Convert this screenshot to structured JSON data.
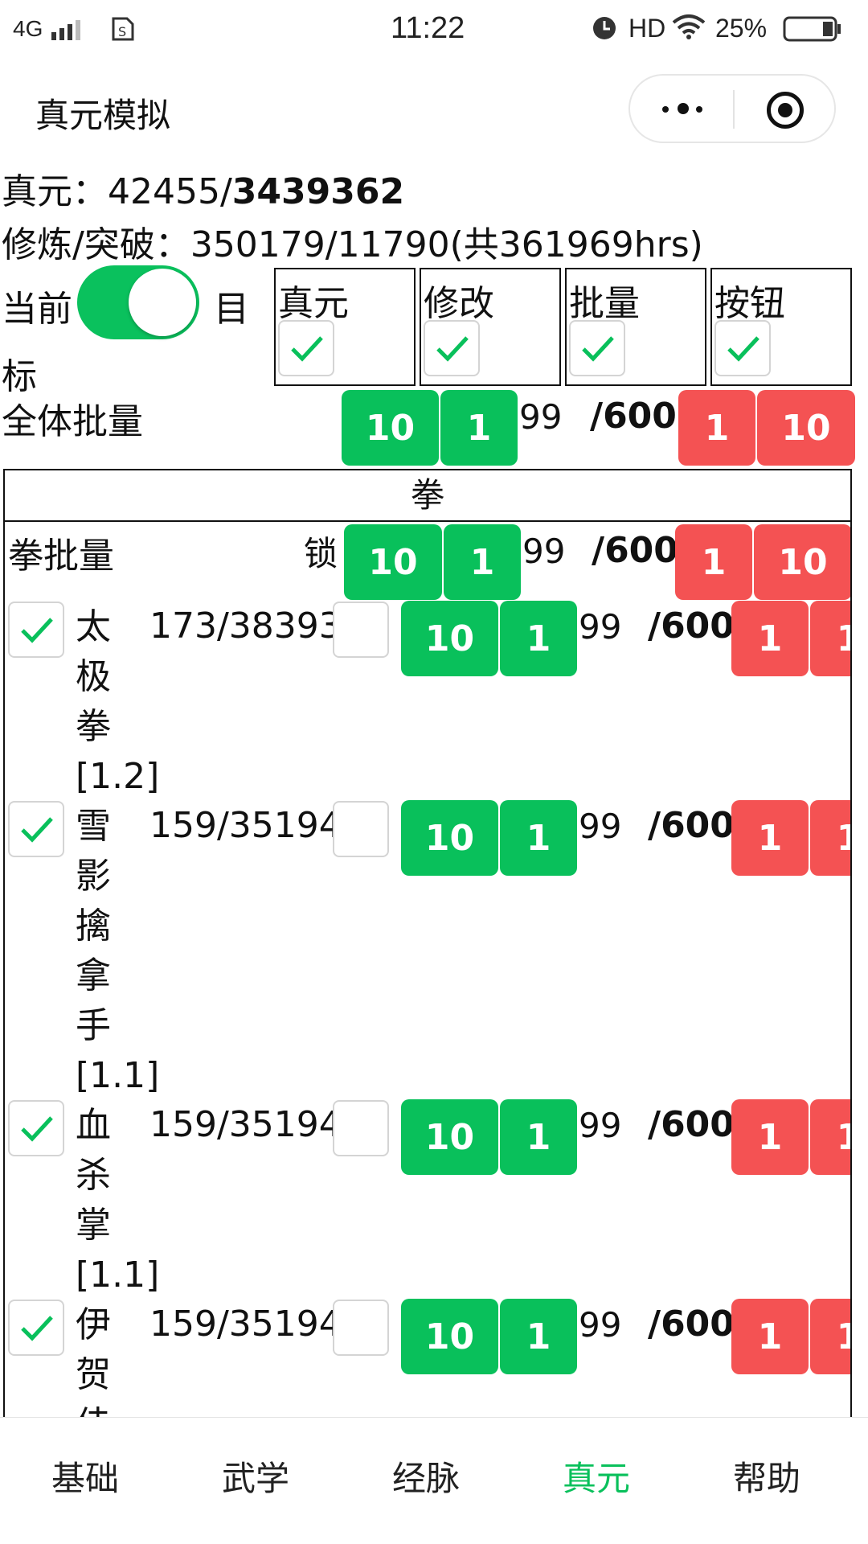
{
  "status_bar": {
    "network": "4G",
    "time": "11:22",
    "hd": "HD",
    "battery": "25%"
  },
  "nav": {
    "title": "真元模拟"
  },
  "summary": {
    "zhenyuan_label": "真元：",
    "zhenyuan_current": "42455/",
    "zhenyuan_total": "3439362",
    "train_line": "修炼/突破：350179/11790(共361969hrs)"
  },
  "mode": {
    "left_label": "当前",
    "right_label": "目",
    "wrap_label": "标",
    "on": true
  },
  "options": [
    {
      "label": "真元",
      "checked": true
    },
    {
      "label": "修改",
      "checked": true
    },
    {
      "label": "批量",
      "checked": true
    },
    {
      "label": "按钮",
      "checked": true
    }
  ],
  "global_batch": {
    "label": "全体批量",
    "plus10": "10",
    "plus1": "1",
    "value": "99",
    "max": "/600",
    "minus1": "1",
    "minus10": "10"
  },
  "group": {
    "title": "拳",
    "batch_label": "拳批量",
    "lock_label": "锁",
    "plus10": "10",
    "plus1": "1",
    "value": "99",
    "max": "/600",
    "minus1": "1",
    "minus10": "10"
  },
  "skills": [
    {
      "name_chars": [
        "太",
        "极",
        "拳",
        "[1.2]"
      ],
      "progress": "173/38393",
      "checked": true,
      "locked": false,
      "plus10": "10",
      "plus1": "1",
      "value": "99",
      "max": "/600",
      "minus1": "1",
      "minus10": "1"
    },
    {
      "name_chars": [
        "雪",
        "影",
        "擒",
        "拿",
        "手",
        "[1.1]"
      ],
      "progress": "159/35194",
      "checked": true,
      "locked": false,
      "plus10": "10",
      "plus1": "1",
      "value": "99",
      "max": "/600",
      "minus1": "1",
      "minus10": "1"
    },
    {
      "name_chars": [
        "血",
        "杀",
        "掌",
        "[1.1]"
      ],
      "progress": "159/35194",
      "checked": true,
      "locked": false,
      "plus10": "10",
      "plus1": "1",
      "value": "99",
      "max": "/600",
      "minus1": "1",
      "minus10": "1"
    },
    {
      "name_chars": [
        "伊",
        "贺",
        "佳"
      ],
      "progress": "159/35194",
      "checked": true,
      "locked": false,
      "plus10": "10",
      "plus1": "1",
      "value": "99",
      "max": "/600",
      "minus1": "1",
      "minus10": "1"
    }
  ],
  "tabs": [
    {
      "label": "基础",
      "active": false
    },
    {
      "label": "武学",
      "active": false
    },
    {
      "label": "经脉",
      "active": false
    },
    {
      "label": "真元",
      "active": true
    },
    {
      "label": "帮助",
      "active": false
    }
  ],
  "colors": {
    "accent_green": "#09c05b",
    "danger_red": "#f45253"
  }
}
